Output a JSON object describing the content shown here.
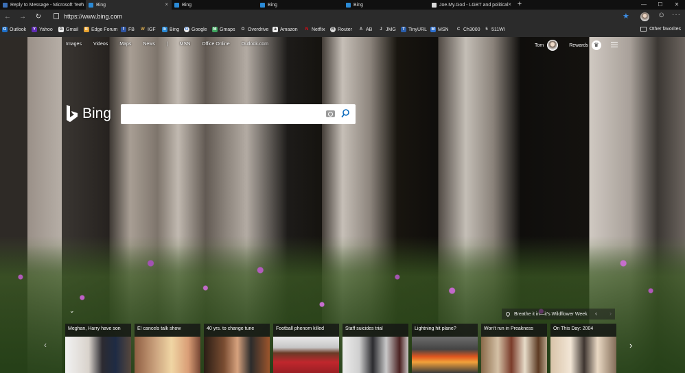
{
  "browser": {
    "tabs": [
      {
        "title": "Reply to Message - Microsoft Tech",
        "icon": "tech-community-icon"
      },
      {
        "title": "Bing",
        "icon": "bing-icon"
      },
      {
        "title": "Bing",
        "icon": "bing-icon"
      },
      {
        "title": "Bing",
        "icon": "bing-icon"
      },
      {
        "title": "Bing",
        "icon": "bing-icon"
      },
      {
        "title": "Joe.My.God - LGBT and political",
        "icon": "site-icon"
      }
    ],
    "url": "https://www.bing.com",
    "favorites": [
      {
        "label": "Outlook",
        "icon": "O"
      },
      {
        "label": "Yahoo",
        "icon": "Y"
      },
      {
        "label": "Gmail",
        "icon": "G"
      },
      {
        "label": "Edge Forum",
        "icon": "E"
      },
      {
        "label": "FB",
        "icon": "f"
      },
      {
        "label": "IGF",
        "icon": "W"
      },
      {
        "label": "Bing",
        "icon": "b"
      },
      {
        "label": "Google",
        "icon": "G"
      },
      {
        "label": "Gmaps",
        "icon": "M"
      },
      {
        "label": "Overdrive",
        "icon": "O"
      },
      {
        "label": "Amazon",
        "icon": "a"
      },
      {
        "label": "Netflix",
        "icon": "N"
      },
      {
        "label": "Router",
        "icon": "R"
      },
      {
        "label": "AB",
        "icon": "A"
      },
      {
        "label": "JMG",
        "icon": "J"
      },
      {
        "label": "TinyURL",
        "icon": "T"
      },
      {
        "label": "MSN",
        "icon": "M"
      },
      {
        "label": "Ch3000",
        "icon": "C"
      },
      {
        "label": "511WI",
        "icon": "5"
      }
    ],
    "other_favorites": "Other favorites"
  },
  "bing": {
    "nav": [
      "Images",
      "Videos",
      "Maps",
      "News",
      "|",
      "MSN",
      "Office Online",
      "Outlook.com"
    ],
    "user_name": "Tom",
    "rewards_label": "Rewards",
    "logo_text": "Bing",
    "search_value": "",
    "caption": "Breathe it in—it's Wildflower Week",
    "cards": [
      {
        "title": "Meghan, Harry have son"
      },
      {
        "title": "E! cancels talk show"
      },
      {
        "title": "40 yrs. to change tune"
      },
      {
        "title": "Football phenom killed"
      },
      {
        "title": "Staff suicides trial"
      },
      {
        "title": "Lightning hit plane?"
      },
      {
        "title": "Won't run in Preakness"
      },
      {
        "title": "On This Day: 2004"
      }
    ]
  },
  "colors": {
    "accent": "#3d8ee6",
    "bing_blue": "#0f6cbd"
  }
}
